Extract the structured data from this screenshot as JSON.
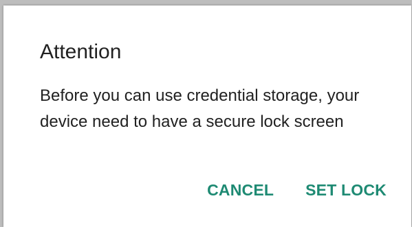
{
  "dialog": {
    "title": "Attention",
    "message": "Before you can use credential storage, your device need to have a secure lock screen",
    "cancel_label": "CANCEL",
    "confirm_label": "SET LOCK"
  },
  "colors": {
    "accent": "#1e8a73",
    "text": "#212121",
    "background": "#ffffff"
  }
}
